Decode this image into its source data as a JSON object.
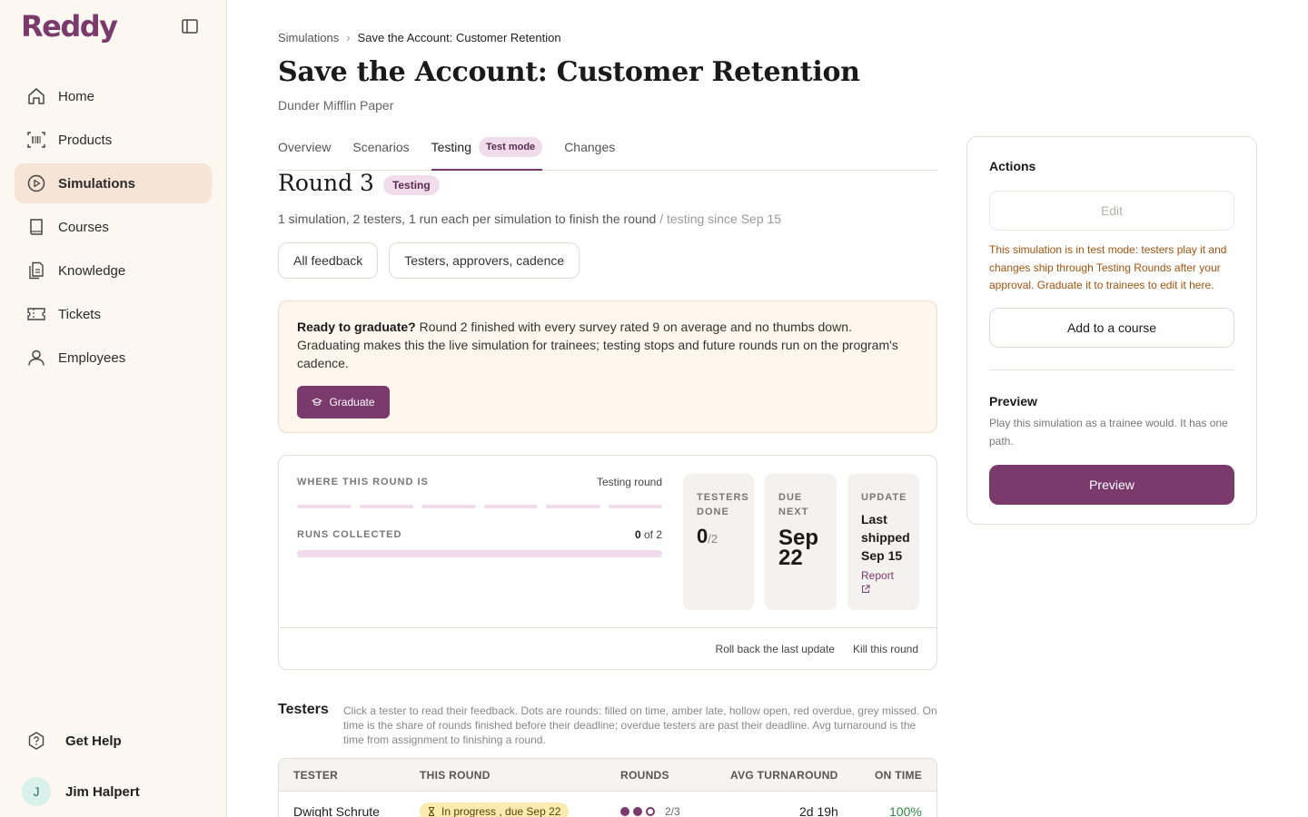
{
  "app": {
    "logo": "Reddy"
  },
  "sidebar": {
    "items": [
      {
        "label": "Home",
        "icon": "home-icon"
      },
      {
        "label": "Products",
        "icon": "barcode-icon"
      },
      {
        "label": "Simulations",
        "icon": "play-circle-icon",
        "active": true
      },
      {
        "label": "Courses",
        "icon": "book-icon"
      },
      {
        "label": "Knowledge",
        "icon": "documents-icon"
      },
      {
        "label": "Tickets",
        "icon": "ticket-icon"
      },
      {
        "label": "Employees",
        "icon": "user-icon"
      }
    ],
    "help_label": "Get Help",
    "user": {
      "initial": "J",
      "name": "Jim Halpert"
    }
  },
  "breadcrumb": {
    "root": "Simulations",
    "current": "Save the Account: Customer Retention"
  },
  "page": {
    "title": "Save the Account: Customer Retention",
    "company": "Dunder Mifflin Paper"
  },
  "tabs": [
    {
      "label": "Overview"
    },
    {
      "label": "Scenarios"
    },
    {
      "label": "Testing",
      "active": true,
      "badge": "Test mode"
    },
    {
      "label": "Changes"
    }
  ],
  "round": {
    "title": "Round 3",
    "badge": "Testing",
    "description": "1 simulation, 2 testers, 1 run each per simulation to finish the round",
    "since": "/ testing since Sep 15",
    "pills": [
      "All feedback",
      "Testers, approvers, cadence"
    ]
  },
  "graduate": {
    "lead": "Ready to graduate?",
    "body": "Round 2 finished with every survey rated 9 on average and no thumbs down. Graduating makes this the live simulation for trainees; testing stops and future rounds run on the program's cadence.",
    "button": "Graduate"
  },
  "status": {
    "where_label": "WHERE THIS ROUND IS",
    "where_value": "Testing round",
    "runs_label": "RUNS COLLECTED",
    "runs_done": "0",
    "runs_total": "of 2",
    "runs_progress": 0,
    "testers_done_label": "TESTERS DONE",
    "testers_done": "0",
    "testers_total": "/2",
    "due_label": "DUE NEXT",
    "due_value": "Sep 22",
    "update_label": "UPDATE",
    "update_value": "Last shipped Sep 15",
    "report_link": "Report",
    "rollback": "Roll back the last update",
    "kill": "Kill this round"
  },
  "testers": {
    "title": "Testers",
    "help": "Click a tester to read their feedback. Dots are rounds: filled on time, amber late, hollow open, red overdue, grey missed. On time is the share of rounds finished before their deadline; overdue testers are past their deadline. Avg turnaround is the time from assignment to finishing a round.",
    "columns": [
      "TESTER",
      "THIS ROUND",
      "ROUNDS",
      "AVG TURNAROUND",
      "ON TIME"
    ],
    "rows": [
      {
        "name": "Dwight Schrute",
        "status": "In progress , due Sep 22",
        "rounds": "2/3",
        "turnaround": "2d 19h",
        "on_time": "100%"
      }
    ]
  },
  "actions": {
    "title": "Actions",
    "edit": "Edit",
    "note": "This simulation is in test mode: testers play it and changes ship through Testing Rounds after your approval. Graduate it to trainees to edit it here.",
    "add_course": "Add to a course",
    "preview_title": "Preview",
    "preview_desc": "Play this simulation as a trainee would. It has one path.",
    "preview_button": "Preview"
  },
  "colors": {
    "brand": "#7a3a6c",
    "accent_bg": "#f1dcec",
    "sidebar_bg": "#fcf8f1",
    "warning_text": "#a3530f",
    "success": "#2f8a3e"
  }
}
